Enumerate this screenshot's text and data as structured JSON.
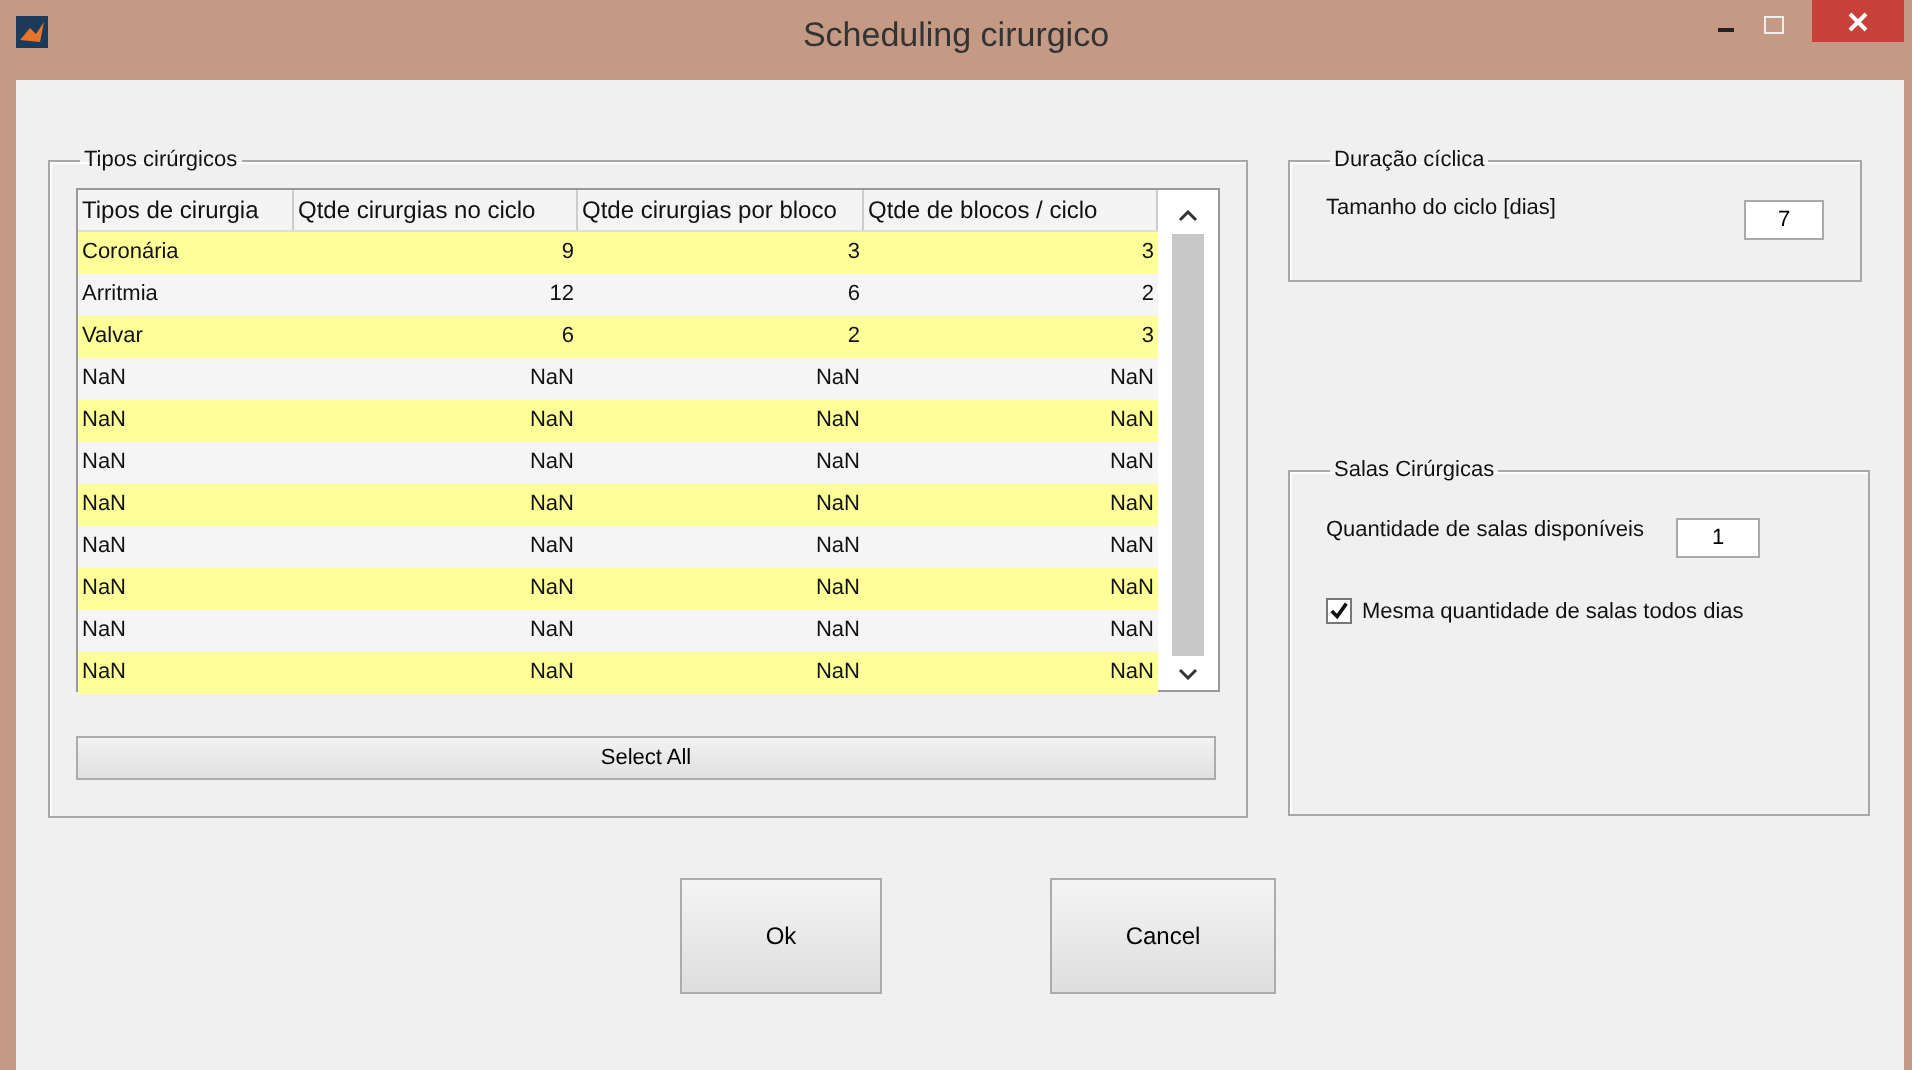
{
  "window": {
    "title": "Scheduling cirurgico"
  },
  "surgery_panel": {
    "title": "Tipos cirúrgicos",
    "table": {
      "columns": [
        "Tipos de cirurgia",
        "Qtde cirurgias no ciclo",
        "Qtde cirurgias por bloco",
        "Qtde de blocos / ciclo"
      ],
      "rows": [
        [
          "Coronária",
          "9",
          "3",
          "3"
        ],
        [
          "Arritmia",
          "12",
          "6",
          "2"
        ],
        [
          "Valvar",
          "6",
          "2",
          "3"
        ],
        [
          "NaN",
          "NaN",
          "NaN",
          "NaN"
        ],
        [
          "NaN",
          "NaN",
          "NaN",
          "NaN"
        ],
        [
          "NaN",
          "NaN",
          "NaN",
          "NaN"
        ],
        [
          "NaN",
          "NaN",
          "NaN",
          "NaN"
        ],
        [
          "NaN",
          "NaN",
          "NaN",
          "NaN"
        ],
        [
          "NaN",
          "NaN",
          "NaN",
          "NaN"
        ],
        [
          "NaN",
          "NaN",
          "NaN",
          "NaN"
        ],
        [
          "NaN",
          "NaN",
          "NaN",
          "NaN"
        ]
      ]
    },
    "select_all": "Select All"
  },
  "cycle_panel": {
    "title": "Duração cíclica",
    "label": "Tamanho do ciclo [dias]",
    "value": "7"
  },
  "rooms_panel": {
    "title": "Salas Cirúrgicas",
    "label": "Quantidade de salas disponíveis",
    "value": "1",
    "checkbox": {
      "label": "Mesma quantidade de salas todos dias",
      "checked": true
    }
  },
  "buttons": [
    "Ok",
    "Cancel"
  ]
}
